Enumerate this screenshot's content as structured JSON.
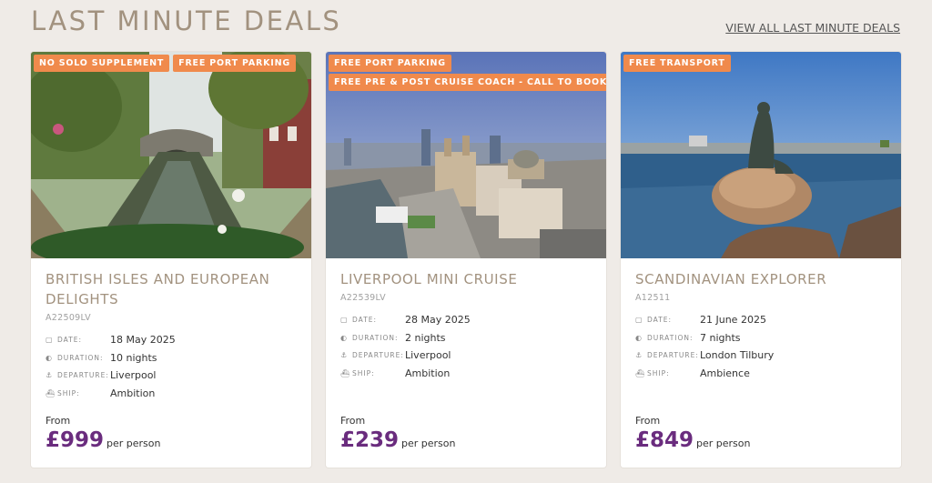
{
  "section": {
    "title": "LAST MINUTE DEALS",
    "view_all": "VIEW ALL LAST MINUTE DEALS"
  },
  "labels": {
    "date": "DATE:",
    "duration": "DURATION:",
    "departure": "DEPARTURE:",
    "ship": "SHIP:",
    "from": "From",
    "per_person": "per person"
  },
  "icons": {
    "date": "calendar-icon",
    "duration": "moon-icon",
    "departure": "anchor-icon",
    "ship": "ship-icon"
  },
  "colors": {
    "badge": "#f08a4c",
    "title": "#a2927f",
    "price": "#6a2c7e",
    "background": "#efebe7"
  },
  "cards": [
    {
      "badges": [
        "NO SOLO SUPPLEMENT",
        "FREE PORT PARKING"
      ],
      "title": "BRITISH ISLES AND EUROPEAN DELIGHTS",
      "code": "A22509LV",
      "date": "18 May 2025",
      "duration": "10 nights",
      "departure": "Liverpool",
      "ship": "Ambition",
      "price": "£999"
    },
    {
      "badges": [
        "FREE PORT PARKING",
        "FREE PRE & POST CRUISE COACH - CALL TO BOOK"
      ],
      "title": "LIVERPOOL MINI CRUISE",
      "code": "A22539LV",
      "date": "28 May 2025",
      "duration": "2 nights",
      "departure": "Liverpool",
      "ship": "Ambition",
      "price": "£239"
    },
    {
      "badges": [
        "FREE TRANSPORT"
      ],
      "title": "SCANDINAVIAN EXPLORER",
      "code": "A12511",
      "date": "21 June 2025",
      "duration": "7 nights",
      "departure": "London Tilbury",
      "ship": "Ambience",
      "price": "£849"
    }
  ]
}
